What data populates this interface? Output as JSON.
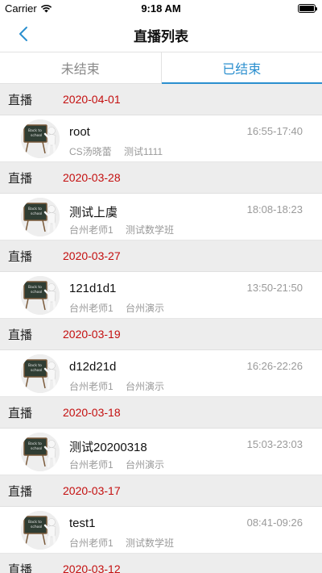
{
  "status_bar": {
    "carrier": "Carrier",
    "time": "9:18 AM"
  },
  "nav": {
    "title": "直播列表",
    "back_icon": "chevron-left-icon"
  },
  "tabs": [
    {
      "label": "未结束",
      "active": false
    },
    {
      "label": "已结束",
      "active": true
    }
  ],
  "colors": {
    "accent": "#2b8fcf",
    "date": "#c40f0f",
    "header_bg": "#ededed"
  },
  "groups": [
    {
      "label": "直播",
      "date": "2020-04-01",
      "item": {
        "name": "root",
        "teacher": "CS汤晓蕾",
        "class": "测试1111",
        "time": "16:55-17:40"
      }
    },
    {
      "label": "直播",
      "date": "2020-03-28",
      "item": {
        "name": "测试上虞",
        "teacher": "台州老师1",
        "class": "测试数学班",
        "time": "18:08-18:23"
      }
    },
    {
      "label": "直播",
      "date": "2020-03-27",
      "item": {
        "name": "121d1d1",
        "teacher": "台州老师1",
        "class": "台州演示",
        "time": "13:50-21:50"
      }
    },
    {
      "label": "直播",
      "date": "2020-03-19",
      "item": {
        "name": "d12d21d",
        "teacher": "台州老师1",
        "class": "台州演示",
        "time": "16:26-22:26"
      }
    },
    {
      "label": "直播",
      "date": "2020-03-18",
      "item": {
        "name": "测试20200318",
        "teacher": "台州老师1",
        "class": "台州演示",
        "time": "15:03-23:03"
      }
    },
    {
      "label": "直播",
      "date": "2020-03-17",
      "item": {
        "name": "test1",
        "teacher": "台州老师1",
        "class": "测试数学班",
        "time": "08:41-09:26"
      }
    },
    {
      "label": "直播",
      "date": "2020-03-12"
    }
  ]
}
